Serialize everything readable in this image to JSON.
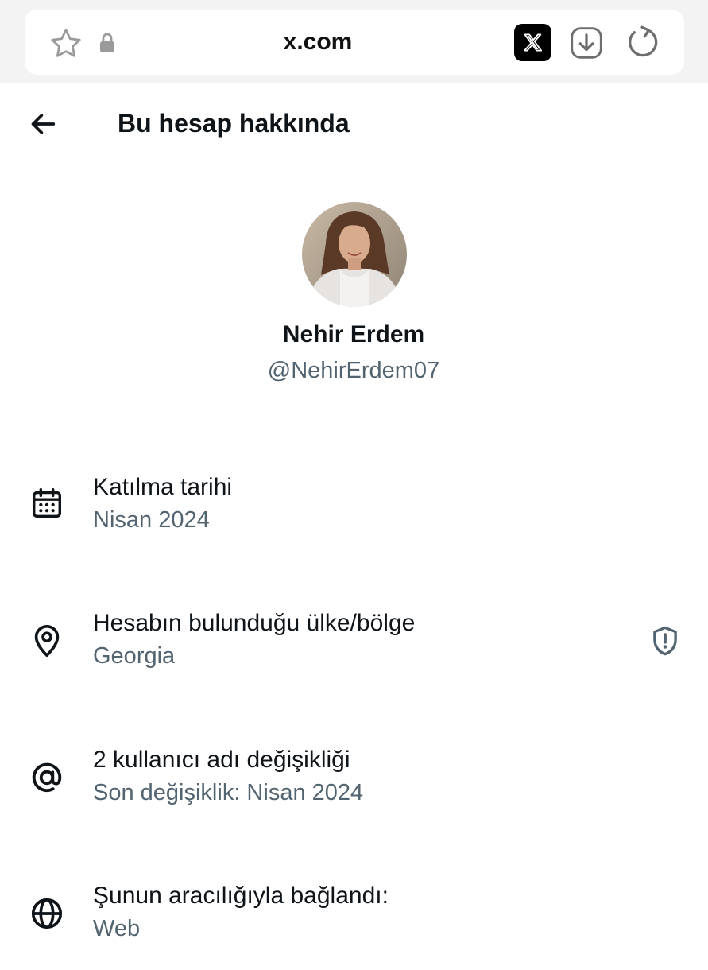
{
  "browser": {
    "url": "x.com",
    "icons": {
      "bookmark": "star-icon",
      "secure": "lock-icon",
      "app": "x-logo-icon",
      "download": "download-icon",
      "reload": "reload-icon"
    }
  },
  "header": {
    "back_icon": "arrow-left-icon",
    "title": "Bu hesap hakkında"
  },
  "profile": {
    "name": "Nehir Erdem",
    "handle": "@NehirErdem07"
  },
  "info_rows": [
    {
      "icon": "calendar-icon",
      "title": "Katılma tarihi",
      "subtitle": "Nisan 2024"
    },
    {
      "icon": "location-pin-icon",
      "title": "Hesabın bulunduğu ülke/bölge",
      "subtitle": "Georgia",
      "trailing_icon": "shield-alert-icon"
    },
    {
      "icon": "at-sign-icon",
      "title": "2 kullanıcı adı değişikliği",
      "subtitle": "Son değişiklik: Nisan 2024"
    },
    {
      "icon": "globe-icon",
      "title": "Şunun aracılığıyla bağlandı:",
      "subtitle": "Web"
    }
  ],
  "colors": {
    "primary_text": "#0f1419",
    "secondary_text": "#536471",
    "chrome_bg": "#f3f3f3"
  }
}
